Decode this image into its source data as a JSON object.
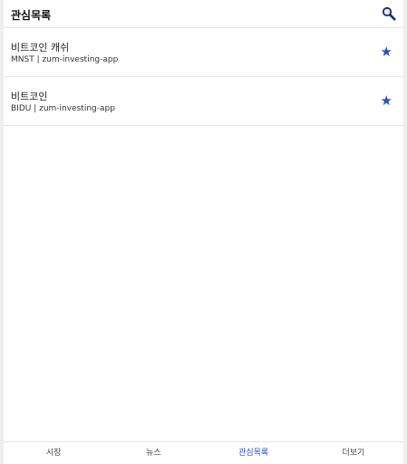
{
  "header": {
    "title": "관심목록",
    "search_icon": "search-icon"
  },
  "watchlist": [
    {
      "name": "비트코인 캐쉬",
      "meta": "MNST | zum-investing-app",
      "favorite": true
    },
    {
      "name": "비트코인",
      "meta": "BIDU | zum-investing-app",
      "favorite": true
    }
  ],
  "tabs": [
    {
      "label": "시장",
      "active": false
    },
    {
      "label": "뉴스",
      "active": false
    },
    {
      "label": "관심목록",
      "active": true
    },
    {
      "label": "더보기",
      "active": false
    }
  ],
  "colors": {
    "accent": "#2b4fc7",
    "divider": "#e4e4e4"
  },
  "star_glyph": "★"
}
